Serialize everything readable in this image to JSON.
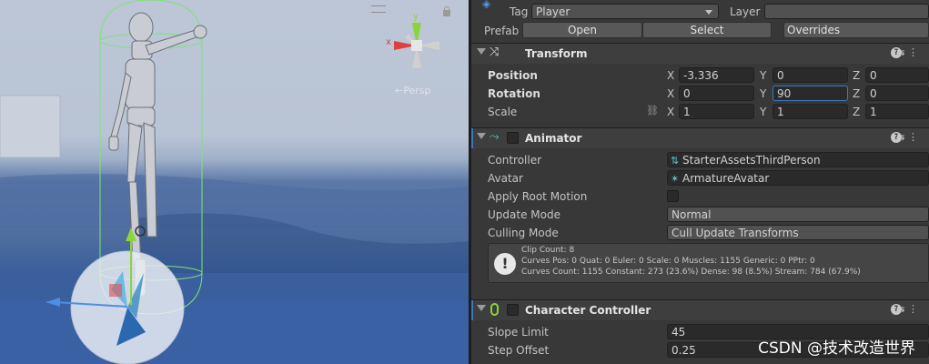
{
  "scene": {
    "persp_label": "←Persp",
    "gizmo_axes": {
      "x": "x",
      "y": "y"
    }
  },
  "inspector": {
    "tag_label": "Tag",
    "tag_value": "Player",
    "layer_label": "Layer",
    "prefab_label": "Prefab",
    "open_label": "Open",
    "select_label": "Select",
    "overrides_label": "Overrides",
    "transform": {
      "title": "Transform",
      "position_label": "Position",
      "rotation_label": "Rotation",
      "scale_label": "Scale",
      "axis_x": "X",
      "axis_y": "Y",
      "axis_z": "Z",
      "position": {
        "x": "-3.336",
        "y": "0",
        "z": "0"
      },
      "rotation": {
        "x": "0",
        "y": "90",
        "z": "0"
      },
      "scale": {
        "x": "1",
        "y": "1",
        "z": "1"
      }
    },
    "animator": {
      "title": "Animator",
      "controller_label": "Controller",
      "controller_value": "StarterAssetsThirdPerson",
      "avatar_label": "Avatar",
      "avatar_value": "ArmatureAvatar",
      "apply_root_motion_label": "Apply Root Motion",
      "update_mode_label": "Update Mode",
      "update_mode_value": "Normal",
      "culling_mode_label": "Culling Mode",
      "culling_mode_value": "Cull Update Transforms",
      "info": {
        "line1": "Clip Count: 8",
        "line2": "Curves Pos: 0 Quat: 0 Euler: 0 Scale: 0 Muscles: 1155 Generic: 0 PPtr: 0",
        "line3": "Curves Count: 1155 Constant: 273 (23.6%) Dense: 98 (8.5%) Stream: 784 (67.9%)"
      }
    },
    "character_controller": {
      "title": "Character Controller",
      "slope_limit_label": "Slope Limit",
      "slope_limit_value": "45",
      "step_offset_label": "Step Offset",
      "step_offset_value": "0.25"
    }
  },
  "watermark": "CSDN @技术改造世界",
  "colors": {
    "accent": "#3a79bb",
    "header": "#3e3e3e",
    "background": "#383838",
    "field": "#2a2a2a"
  }
}
